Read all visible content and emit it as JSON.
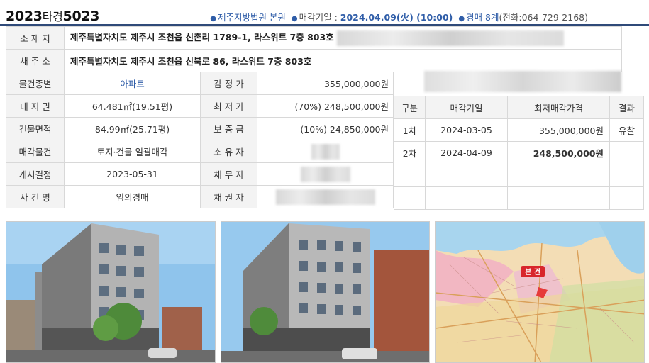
{
  "header": {
    "case_year": "2023",
    "case_type": "타경",
    "case_num": "5023",
    "court": "제주지방법원 본원",
    "sale_date_label": "매각기일 : ",
    "sale_date": "2024.04.09(火) (10:00)",
    "dept": "경매 8계",
    "phone": "(전화:064-729-2168)"
  },
  "info": {
    "location_label": "소 재 지",
    "location": "제주특별자치도 제주시 조천읍 신촌리 1789-1, 라스위트 7층 803호",
    "new_addr_label": "새 주 소",
    "new_addr": "제주특별자치도 제주시 조천읍 신북로 86, 라스위트 7층 803호",
    "type_label": "물건종별",
    "type": "아파트",
    "appraisal_label": "감 정 가",
    "appraisal": "355,000,000원",
    "land_label": "대 지 권",
    "land": "64.481㎡(19.51평)",
    "min_label": "최 저 가",
    "min": "(70%) 248,500,000원",
    "area_label": "건물면적",
    "area": "84.99㎡(25.71평)",
    "deposit_label": "보 증 금",
    "deposit": "(10%) 24,850,000원",
    "sale_obj_label": "매각물건",
    "sale_obj": "토지·건물 일괄매각",
    "owner_label": "소 유 자",
    "start_label": "개시결정",
    "start": "2023-05-31",
    "debtor_label": "채 무 자",
    "case_name_label": "사 건 명",
    "case_name": "임의경매",
    "creditor_label": "채 권 자"
  },
  "history": {
    "headers": [
      "구분",
      "매각기일",
      "최저매각가격",
      "결과"
    ],
    "rows": [
      {
        "round": "1차",
        "date": "2024-03-05",
        "price": "355,000,000원",
        "result": "유찰"
      },
      {
        "round": "2차",
        "date": "2024-04-09",
        "price": "248,500,000원",
        "result": ""
      }
    ]
  },
  "map": {
    "label": "본 건"
  },
  "colors": {
    "accent": "#2f5da8",
    "border": "#2f4a79",
    "label_bg": "#f3f3f3"
  }
}
